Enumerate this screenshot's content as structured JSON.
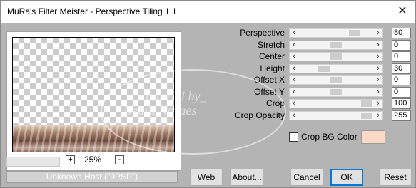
{
  "window": {
    "title": "MuRa's Filter Meister - Perspective Tiling 1.1",
    "close_glyph": "✕"
  },
  "preview": {
    "zoom": "25%",
    "zoom_plus": "+",
    "zoom_minus": "-",
    "status": "Unknown Host (\"9PSP\")"
  },
  "params": [
    {
      "label": "Perspective",
      "value": "80",
      "slider_fraction": 0.8
    },
    {
      "label": "Stretch",
      "value": "0",
      "slider_fraction": 0.5
    },
    {
      "label": "Center",
      "value": "0",
      "slider_fraction": 0.5
    },
    {
      "label": "Height",
      "value": "30",
      "slider_fraction": 0.3
    },
    {
      "label": "Offset X",
      "value": "0",
      "slider_fraction": 0.5
    },
    {
      "label": "Offset Y",
      "value": "0",
      "slider_fraction": 0.5
    },
    {
      "label": "Crop",
      "value": "100",
      "slider_fraction": 1.0
    },
    {
      "label": "Crop Opacity",
      "value": "255",
      "slider_fraction": 1.0
    }
  ],
  "crop_bg": {
    "label": "Crop BG Color",
    "checked": false,
    "color": "#fcd9c6"
  },
  "buttons": {
    "web": "Web",
    "about": "About...",
    "cancel": "Cancel",
    "ok": "OK",
    "reset": "Reset"
  },
  "watermark": {
    "line1": "Tutorial by_",
    "line2": "Neusa Novaes"
  },
  "icons": {
    "slider_left": "left-arrow-icon",
    "slider_right": "right-arrow-icon",
    "close": "close-icon"
  }
}
